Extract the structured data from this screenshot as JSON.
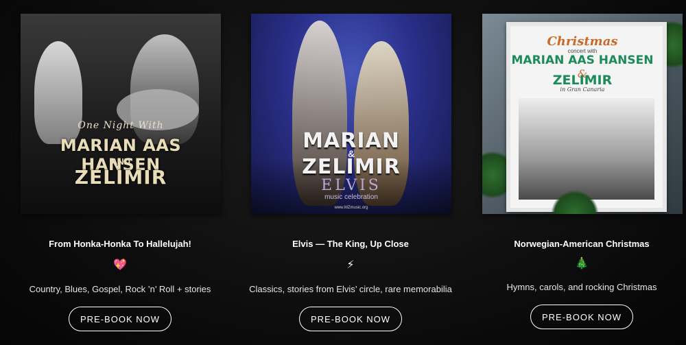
{
  "cards": [
    {
      "poster": {
        "line1": "One Night With",
        "line2": "MARIAN AAS HANSEN",
        "line3": "AND",
        "line4": "ZELIMIR"
      },
      "title": "From Honka-Honka To Hallelujah!",
      "icon": "sparkling-heart-icon",
      "icon_glyph": "💖",
      "description": "Country, Blues, Gospel, Rock ’n’ Roll + stories",
      "button_label": "PRE-BOOK NOW"
    },
    {
      "poster": {
        "line1": "MARIAN",
        "line2": "&",
        "line3": "ZELIMIR",
        "line4": "ELVIS",
        "line5": "music celebration",
        "line6": "www.MZmusic.org"
      },
      "title": "Elvis — The King, Up Close",
      "icon": "lightning-icon",
      "icon_glyph": "⚡",
      "description": "Classics, stories from Elvis’ circle, rare memorabilia",
      "button_label": "PRE-BOOK NOW"
    },
    {
      "poster": {
        "line1": "Christmas",
        "line2": "concert with",
        "line3": "MARIAN AAS HANSEN",
        "line4": "&",
        "line5": "ZELIMIR",
        "line6": "in Gran Canaria"
      },
      "title": "Norwegian-American Christmas",
      "icon": "christmas-tree-icon",
      "icon_glyph": "🎄",
      "description": "Hymns, carols, and rocking Christmas",
      "button_label": "PRE-BOOK NOW"
    }
  ]
}
